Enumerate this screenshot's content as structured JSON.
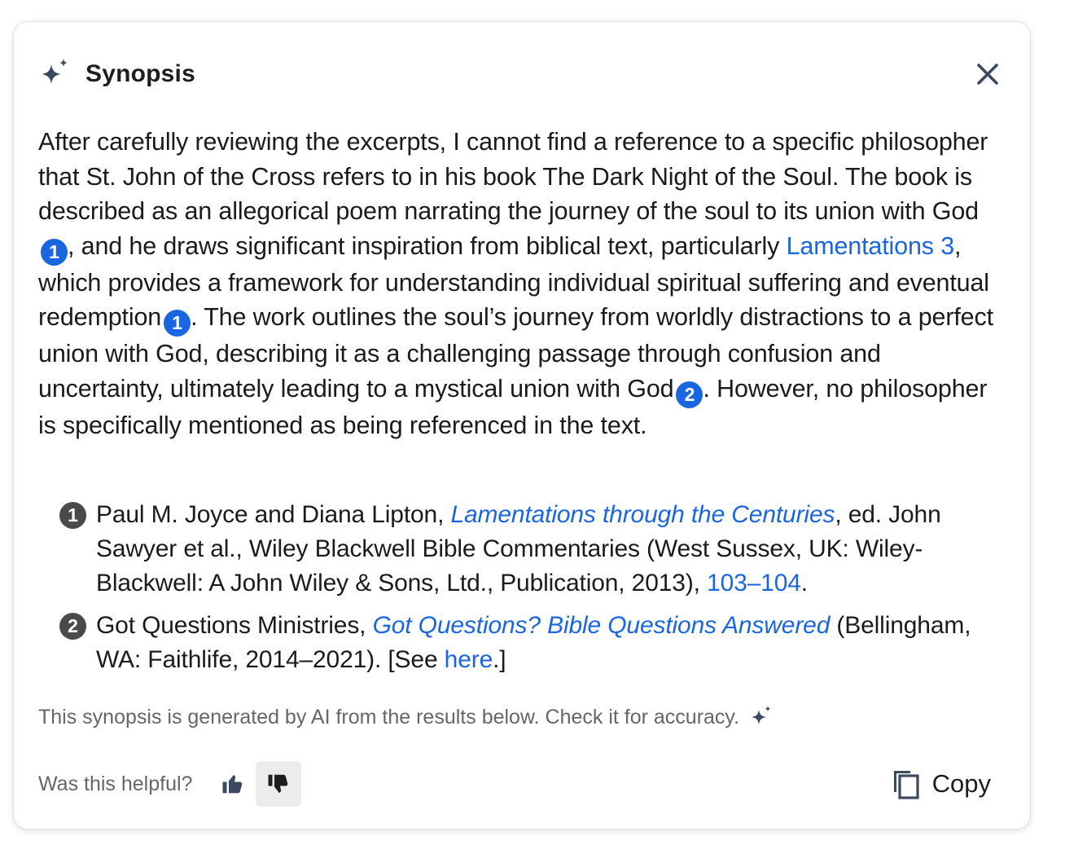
{
  "header": {
    "title": "Synopsis",
    "icon": "sparkle-icon"
  },
  "body": {
    "p1": "After carefully reviewing the excerpts, I cannot find a reference to a specific philosopher that St. John of the Cross refers to in his book The Dark Night of the Soul. The book is described as an allegorical poem narrating the journey of the soul to its union with God",
    "cite1": "1",
    "p2": ", and he draws significant inspiration from biblical text, particularly ",
    "link_lamentations": "Lamentations 3",
    "p3": ", which provides a framework for understanding individual spiritual suffering and eventual redemption",
    "cite2": "1",
    "p4": ". The work outlines the soul’s journey from worldly distractions to a perfect union with God, describing it as a challenging passage through confusion and uncertainty, ultimately leading to a mystical union with God",
    "cite3": "2",
    "p5": ". However, no philosopher is specifically mentioned as being referenced in the text."
  },
  "references": [
    {
      "num": "1",
      "before": "Paul M. Joyce and Diana Lipton, ",
      "title": "Lamentations through the Centuries",
      "middle": ", ed. John Sawyer et al., Wiley Blackwell Bible Commentaries (West Sussex, UK: Wiley-Blackwell: A John Wiley & Sons, Ltd., Publication, 2013), ",
      "link": "103–104",
      "after": "."
    },
    {
      "num": "2",
      "before": "Got Questions Ministries, ",
      "title": "Got Questions? Bible Questions Answered",
      "middle": " (Bellingham, WA: Faithlife, 2014–2021). [See ",
      "link": "here",
      "after": ".]"
    }
  ],
  "footer": {
    "disclaimer": "This synopsis is generated by AI from the results below. Check it for accuracy.",
    "helpful_question": "Was this helpful?",
    "copy_label": "Copy"
  },
  "colors": {
    "accent": "#1a66e0",
    "icon": "#3b4a5e",
    "muted": "#666666"
  }
}
